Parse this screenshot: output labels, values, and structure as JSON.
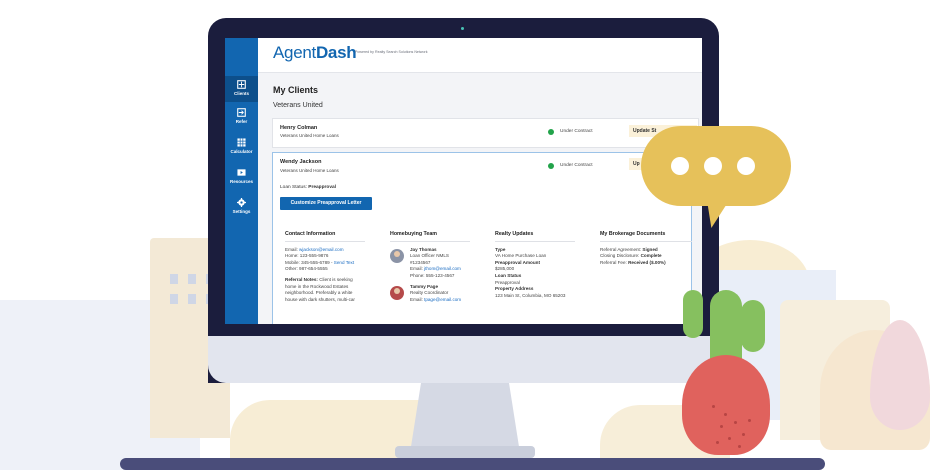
{
  "app": {
    "logo_light": "Agent",
    "logo_bold": "Dash",
    "powered_by": "Powered by Realty Search Solutions Network"
  },
  "sidebar": {
    "items": [
      {
        "label": "Clients",
        "icon": "clients-icon",
        "active": true
      },
      {
        "label": "Refer",
        "icon": "refer-icon"
      },
      {
        "label": "Calculator",
        "icon": "calculator-icon"
      },
      {
        "label": "Resources",
        "icon": "resources-icon"
      },
      {
        "label": "Settings",
        "icon": "settings-icon"
      }
    ]
  },
  "main": {
    "title": "My Clients",
    "company": "Veterans United",
    "clients": [
      {
        "name": "Henry Colman",
        "org": "Veterans United Home Loans",
        "status": "Under Contract",
        "action": "Update St"
      },
      {
        "name": "Wendy Jackson",
        "org": "Veterans United Home Loans",
        "status": "Under Contract",
        "action": "Up"
      }
    ],
    "loan_status_label": "Loan Status:",
    "loan_status_value": "Preapproval",
    "customize_button": "Customize Preapproval Letter",
    "contact": {
      "heading": "Contact Information",
      "email_label": "Email:",
      "email": "wjackson@email.com",
      "home": "Home: 123-555-9876",
      "mobile": "Mobile: 345-555-6789 -",
      "send_text": "Send Text",
      "other": "Other: 987-654-5555",
      "notes_label": "Referral Notes:",
      "notes_line1": "Client is seeking",
      "notes_line2": "home in the Rockwood Estates",
      "notes_line3": "neighborhood. Preferably a white",
      "notes_line4": "house with dark shutters, multi-car"
    },
    "team": {
      "heading": "Homebuying Team",
      "members": [
        {
          "name": "Jay Thomas",
          "role": "Loan Officer NMLS",
          "id": "#1234567",
          "email_label": "Email:",
          "email": "jthom@email.com",
          "phone": "Phone: 555-123-4567"
        },
        {
          "name": "Tammy Page",
          "role": "Realty Coordinator",
          "email_label": "Email:",
          "email": "tpage@email.com"
        }
      ]
    },
    "realty": {
      "heading": "Realty Updates",
      "type_label": "Type",
      "type_value": "VA Home Purchase Loan",
      "amount_label": "Preapproval Amount",
      "amount_value": "$285,000",
      "loan_status_label": "Loan Status",
      "loan_status_value": "Preapproval",
      "address_label": "Property Address",
      "address_value": "123 Main St, Columbia, MO 65203"
    },
    "documents": {
      "heading": "My Brokerage Documents",
      "agreement_label": "Referral Agreement:",
      "agreement_value": "Signed",
      "closing_label": "Closing Disclosure:",
      "closing_value": "Complete",
      "fee_label": "Referral Fee:",
      "fee_value": "Received ($.00%)"
    }
  },
  "colors": {
    "brand_blue": "#1266b0",
    "status_green": "#22a34a",
    "bubble_yellow": "#e6c15a",
    "pot_red": "#e0625d",
    "cactus_green": "#86c05f"
  }
}
